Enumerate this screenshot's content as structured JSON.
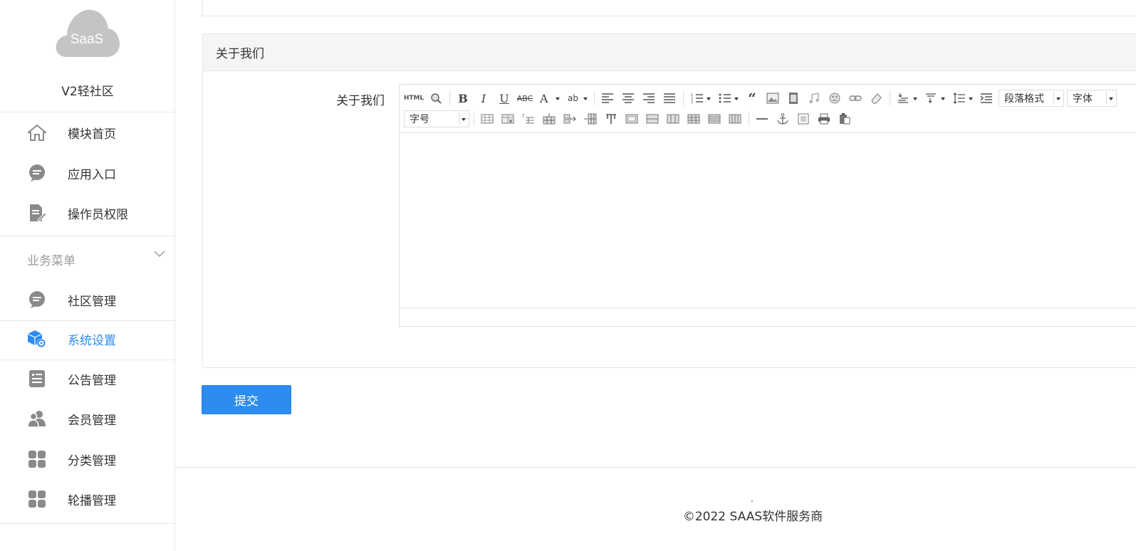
{
  "sidebar": {
    "logo_text": "SaaS",
    "site_name": "V2轻社区",
    "top_items": [
      {
        "label": "模块首页",
        "icon": "home-icon"
      },
      {
        "label": "应用入口",
        "icon": "chat-icon"
      },
      {
        "label": "操作员权限",
        "icon": "document-edit-icon"
      }
    ],
    "section_title": "业务菜单",
    "section_items": [
      {
        "label": "社区管理",
        "icon": "chat-icon"
      },
      {
        "label": "系统设置",
        "icon": "cube-gear-icon",
        "active": true
      },
      {
        "label": "公告管理",
        "icon": "notice-icon"
      },
      {
        "label": "会员管理",
        "icon": "users-icon"
      },
      {
        "label": "分类管理",
        "icon": "grid-icon"
      },
      {
        "label": "轮播管理",
        "icon": "grid-icon"
      }
    ]
  },
  "main": {
    "panel_title": "关于我们",
    "field_label": "关于我们",
    "editor": {
      "html_button": "HTML",
      "paragraph_select": "段落格式",
      "font_select": "字体",
      "size_select": "字号",
      "content": ""
    },
    "submit_label": "提交"
  },
  "colors": {
    "accent": "#2d8cf0",
    "icon_gray": "#888888",
    "border": "#e5e5e5"
  },
  "footer": {
    "dot": ".",
    "copyright": "©2022 SAAS软件服务商"
  }
}
